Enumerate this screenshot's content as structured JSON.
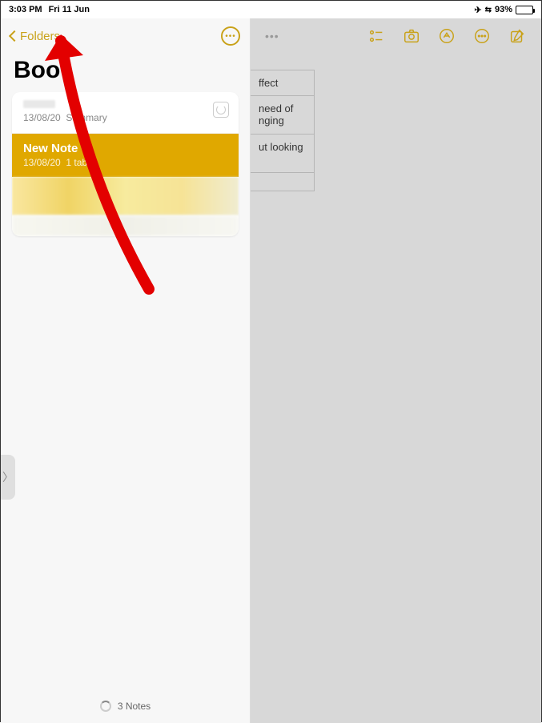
{
  "status": {
    "time": "3:03 PM",
    "date": "Fri 11 Jun",
    "battery_pct": "93%"
  },
  "sidebar": {
    "back_label": "Folders",
    "folder_title": "Boo",
    "notes": [
      {
        "title": "",
        "date": "13/08/20",
        "summary": "Summary"
      },
      {
        "title": "New Note",
        "date": "13/08/20",
        "summary": "1 table"
      }
    ],
    "footer": "3 Notes"
  },
  "detail": {
    "table_rows": [
      "ffect",
      "need of\nnging",
      "ut looking",
      ""
    ]
  },
  "colors": {
    "accent": "#c9a21a",
    "selected": "#e0a800"
  }
}
